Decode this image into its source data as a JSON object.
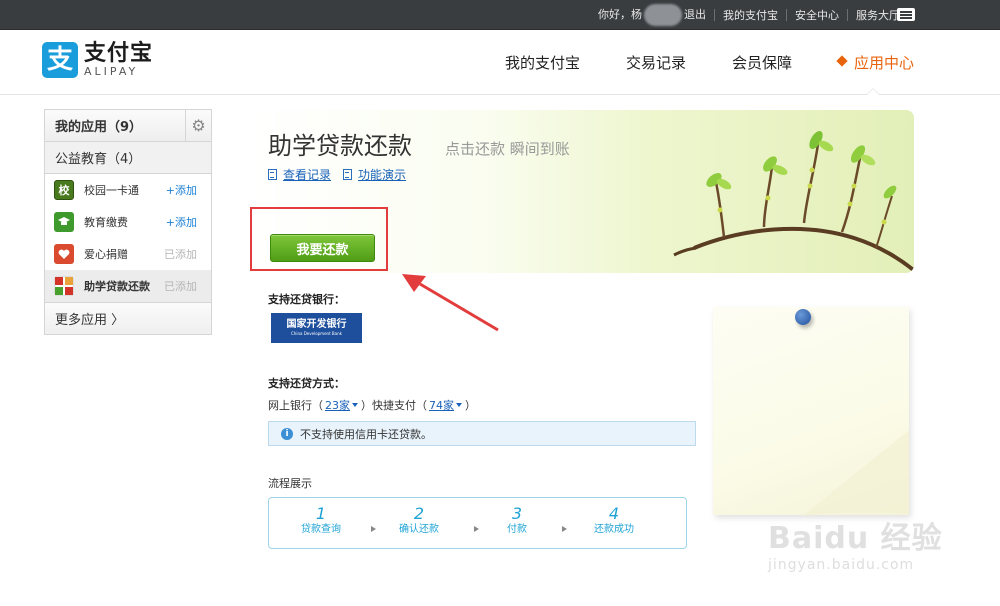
{
  "topbar": {
    "greeting": "你好，",
    "user_prefix": "杨",
    "logout": "退出",
    "my_alipay": "我的支付宝",
    "security": "安全中心",
    "service": "服务大厅"
  },
  "header": {
    "logo_mark": "支",
    "logo_cn": "支付宝",
    "logo_en": "ALIPAY",
    "nav": [
      "我的支付宝",
      "交易记录",
      "会员保障",
      "应用中心"
    ]
  },
  "sidebar": {
    "my_apps": "我的应用（9）",
    "category": "公益教育（4）",
    "items": [
      {
        "label": "校园一卡通",
        "icon_char": "校",
        "action": "+添加",
        "color": "#4a7a1e"
      },
      {
        "label": "教育缴费",
        "icon_char": "",
        "action": "+添加",
        "color": "#3e9a2d"
      },
      {
        "label": "爱心捐赠",
        "icon_char": "",
        "action": "已添加",
        "color": "#d94a2e"
      },
      {
        "label": "助学贷款还款",
        "icon_char": "",
        "action": "已添加",
        "color": "#d4332a"
      }
    ],
    "more": "更多应用 〉"
  },
  "banner": {
    "title": "助学贷款还款",
    "subtitle": "点击还款 瞬间到账",
    "link_records": "查看记录",
    "link_demo": "功能演示"
  },
  "repay_button": "我要还款",
  "bank": {
    "label": "支持还贷银行：",
    "logo_cn": "国家开发银行",
    "logo_en": "China Development Bank"
  },
  "methods": {
    "label": "支持还贷方式：",
    "online_prefix": "网上银行（",
    "online_count": "23家",
    "quick_prefix": "）快捷支付（",
    "quick_count": "74家",
    "suffix": "）"
  },
  "notice": "不支持使用信用卡还贷款。",
  "flow": {
    "label": "流程展示",
    "steps": [
      {
        "num": "1",
        "text": "贷款查询"
      },
      {
        "num": "2",
        "text": "确认还款"
      },
      {
        "num": "3",
        "text": "付款"
      },
      {
        "num": "4",
        "text": "还款成功"
      }
    ]
  },
  "watermark": {
    "big": "Baidu 经验",
    "small": "jingyan.baidu.com"
  }
}
